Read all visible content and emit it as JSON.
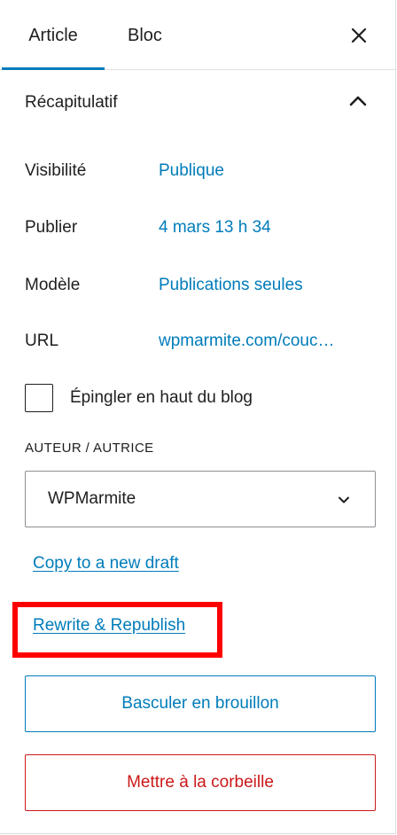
{
  "tabs": {
    "article": "Article",
    "bloc": "Bloc"
  },
  "summary": {
    "title": "Récapitulatif"
  },
  "rows": {
    "visibility": {
      "label": "Visibilité",
      "value": "Publique"
    },
    "publish": {
      "label": "Publier",
      "value": "4 mars 13 h 34"
    },
    "template": {
      "label": "Modèle",
      "value": "Publications seules"
    },
    "url": {
      "label": "URL",
      "value": "wpmarmite.com/couc…"
    }
  },
  "sticky": {
    "label": "Épingler en haut du blog",
    "checked": false
  },
  "author": {
    "label": "AUTEUR / AUTRICE",
    "selected": "WPMarmite"
  },
  "links": {
    "copy": "Copy to a new draft",
    "rewrite": "Rewrite & Republish"
  },
  "buttons": {
    "draft": "Basculer en brouillon",
    "trash": "Mettre à la corbeille"
  },
  "colors": {
    "accent": "#007cba",
    "danger": "#cc1818",
    "highlight": "#ff0000"
  },
  "icons": {
    "close": "close-icon",
    "collapse": "chevron-up-icon",
    "dropdown": "chevron-down-icon"
  }
}
